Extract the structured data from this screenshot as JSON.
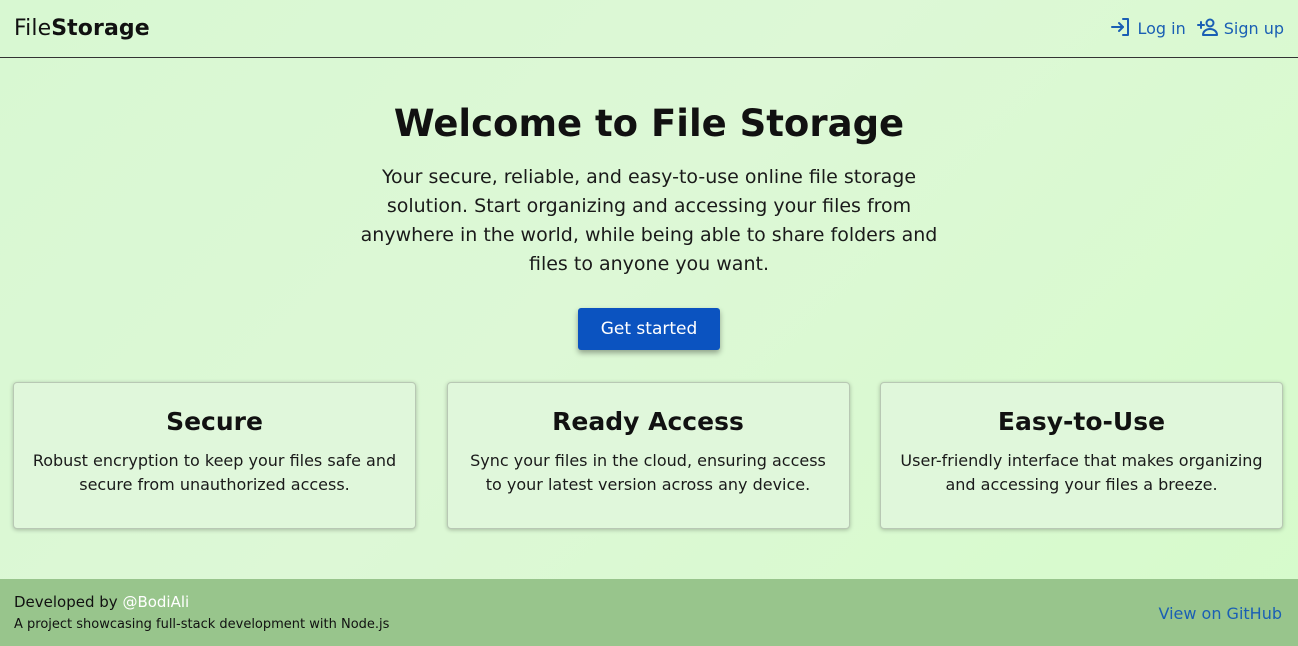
{
  "header": {
    "brand_light": "File",
    "brand_bold": "Storage",
    "login_label": "Log in",
    "signup_label": "Sign up",
    "login_icon": "login-icon",
    "signup_icon": "person-add-icon"
  },
  "hero": {
    "title": "Welcome to File Storage",
    "text": "Your secure, reliable, and easy-to-use online file storage solution. Start organizing and accessing your files from anywhere in the world, while being able to share folders and files to anyone you want.",
    "cta_label": "Get started"
  },
  "features": [
    {
      "title": "Secure",
      "text": "Robust encryption to keep your files safe and secure from unauthorized access."
    },
    {
      "title": "Ready Access",
      "text": "Sync your files in the cloud, ensuring access to your latest version across any device."
    },
    {
      "title": "Easy-to-Use",
      "text": "User-friendly interface that makes organizing and accessing your files a breeze."
    }
  ],
  "footer": {
    "developed_by": "Developed by ",
    "handle": "@BodiAli",
    "description": "A project showcasing full-stack development with Node.js",
    "github_label": "View on GitHub"
  },
  "colors": {
    "accent": "#0b53c0",
    "link": "#1a5fb4",
    "footer_bg": "#98c58c",
    "page_bg": "#d8f8d2"
  }
}
